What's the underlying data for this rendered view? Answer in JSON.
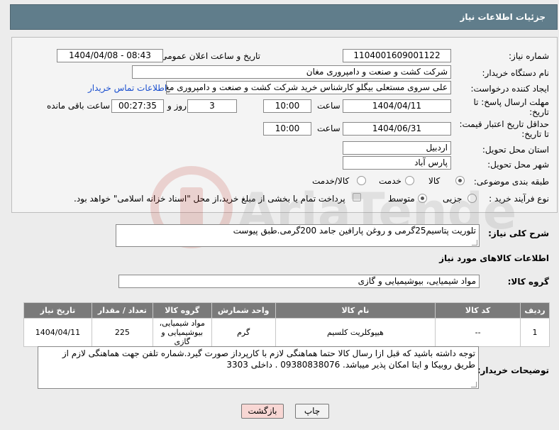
{
  "header": {
    "title": "جزئیات اطلاعات نیاز"
  },
  "form": {
    "need_number_label": "شماره نیاز:",
    "need_number": "1104001609001122",
    "announce_label": "تاریخ و ساعت اعلان عمومی:",
    "announce_value": "1404/04/08 - 08:43",
    "buyer_org_label": "نام دستگاه خریدار:",
    "buyer_org": "شرکت کشت و صنعت و دامپروری مغان",
    "creator_label": "ایجاد کننده درخواست:",
    "creator": "علی سروی مستعلی بیگلو کارشناس خرید شرکت کشت و صنعت و دامپروری مغ",
    "contact_link": "اطلاعات تماس خریدار",
    "deadline_label_1": "مهلت ارسال پاسخ: تا",
    "deadline_label_2": "تاریخ:",
    "deadline_date": "1404/04/11",
    "time_label": "ساعت",
    "deadline_time": "10:00",
    "days_value": "3",
    "days_label": "روز و",
    "remaining_time": "00:27:35",
    "remaining_label": "ساعت باقی مانده",
    "price_label_1": "حداقل تاریخ اعتبار قیمت:",
    "price_label_2": "تا تاریخ:",
    "price_date": "1404/06/31",
    "price_time": "10:00",
    "province_label": "استان محل تحویل:",
    "province": "اردبیل",
    "city_label": "شهر محل تحویل:",
    "city": "پارس آباد",
    "category_label": "طبقه بندی موضوعی:",
    "category_options": [
      "کالا",
      "خدمت",
      "کالا/خدمت"
    ],
    "process_label": "نوع فرآیند خرید :",
    "process_options": [
      "جزیی",
      "متوسط"
    ],
    "payment_note": "پرداخت تمام یا بخشی از مبلغ خرید،از محل \"اسناد خزانه اسلامی\" خواهد بود."
  },
  "description": {
    "label": "شرح کلی نیاز:",
    "text": "تلوریت پتاسیم25گرمی  و روغن پارافین جامد 200گرمی.طبق پیوست"
  },
  "goods": {
    "section_title": "اطلاعات کالاهای مورد نیاز",
    "group_label": "گروه کالا:",
    "group_value": "مواد شیمیایی، بیوشیمیایی و  گازی"
  },
  "table": {
    "headers": [
      "ردیف",
      "کد کالا",
      "نام کالا",
      "واحد شمارش",
      "گروه کالا",
      "تعداد / مقدار",
      "تاریخ نیاز"
    ],
    "rows": [
      {
        "row": "1",
        "code": "--",
        "name": "هیپوکلریت کلسیم",
        "unit": "گرم",
        "group": "مواد شیمیایی، بیوشیمیایی و گازی",
        "qty": "225",
        "date": "1404/04/11"
      }
    ]
  },
  "buyer_notes": {
    "label": "توضیحات خریدار:",
    "text": "توجه داشته باشید که قبل ازا رسال کالا حتما هماهنگی لازم با کارپرداز صورت گیرد.شماره تلفن جهت هماهنگی لازم از طریق روبیکا و ایتا امکان پذیر میباشد. 09380838076  . داخلی 3303"
  },
  "buttons": {
    "print": "چاپ",
    "back": "بازگشت"
  },
  "watermark": {
    "text": "AriaTender.neT"
  },
  "colors": {
    "header": "#607d8b",
    "table_header": "#7a7a7a",
    "back_button": "#f8d7d4",
    "link": "#1a4fcf"
  }
}
